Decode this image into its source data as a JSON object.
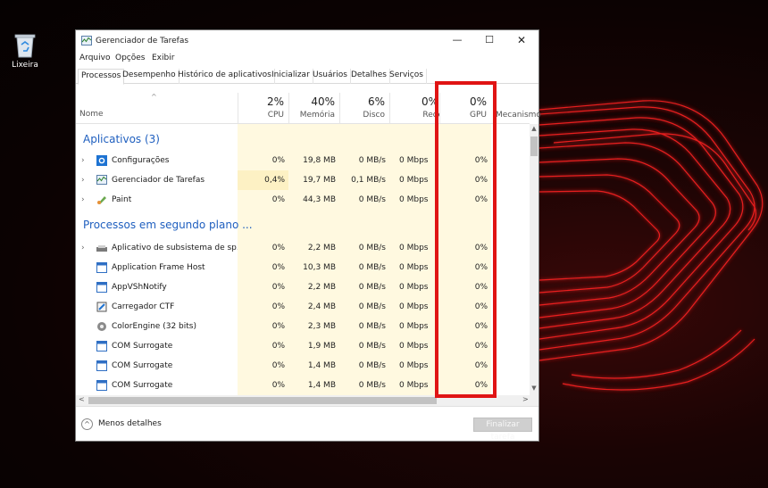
{
  "desktop": {
    "recycle_label": "Lixeira"
  },
  "window": {
    "title": "Gerenciador de Tarefas",
    "buttons": {
      "minimize": "—",
      "maximize": "☐",
      "close": "✕"
    },
    "menu": [
      "Arquivo",
      "Opções",
      "Exibir"
    ],
    "tabs": [
      "Processos",
      "Desempenho",
      "Histórico de aplicativos",
      "Inicializar",
      "Usuários",
      "Detalhes",
      "Serviços"
    ],
    "active_tab": "Processos"
  },
  "header": {
    "name": "Nome",
    "cpu": {
      "pct": "2%",
      "label": "CPU"
    },
    "memory": {
      "pct": "40%",
      "label": "Memória"
    },
    "disk": {
      "pct": "6%",
      "label": "Disco"
    },
    "network": {
      "pct": "0%",
      "label": "Rede"
    },
    "gpu": {
      "pct": "0%",
      "label": "GPU"
    },
    "engine": "Mecanismo"
  },
  "groups": {
    "apps": "Aplicativos (3)",
    "background": "Processos em segundo plano ..."
  },
  "apps": [
    {
      "name": "Configurações",
      "icon": "settings-gear-icon",
      "cpu": "0%",
      "mem": "19,8 MB",
      "disk": "0 MB/s",
      "net": "0 Mbps",
      "gpu": "0%"
    },
    {
      "name": "Gerenciador de Tarefas",
      "icon": "task-manager-icon",
      "cpu": "0,4%",
      "mem": "19,7 MB",
      "disk": "0,1 MB/s",
      "net": "0 Mbps",
      "gpu": "0%"
    },
    {
      "name": "Paint",
      "icon": "paint-icon",
      "cpu": "0%",
      "mem": "44,3 MB",
      "disk": "0 MB/s",
      "net": "0 Mbps",
      "gpu": "0%"
    }
  ],
  "background": [
    {
      "name": "Aplicativo de subsistema de sp...",
      "icon": "spooler-icon",
      "cpu": "0%",
      "mem": "2,2 MB",
      "disk": "0 MB/s",
      "net": "0 Mbps",
      "gpu": "0%"
    },
    {
      "name": "Application Frame Host",
      "icon": "app-window-icon",
      "cpu": "0%",
      "mem": "10,3 MB",
      "disk": "0 MB/s",
      "net": "0 Mbps",
      "gpu": "0%"
    },
    {
      "name": "AppVShNotify",
      "icon": "app-window-icon",
      "cpu": "0%",
      "mem": "2,2 MB",
      "disk": "0 MB/s",
      "net": "0 Mbps",
      "gpu": "0%"
    },
    {
      "name": "Carregador CTF",
      "icon": "ctf-loader-icon",
      "cpu": "0%",
      "mem": "2,4 MB",
      "disk": "0 MB/s",
      "net": "0 Mbps",
      "gpu": "0%"
    },
    {
      "name": "ColorEngine (32 bits)",
      "icon": "gear-cog-icon",
      "cpu": "0%",
      "mem": "2,3 MB",
      "disk": "0 MB/s",
      "net": "0 Mbps",
      "gpu": "0%"
    },
    {
      "name": "COM Surrogate",
      "icon": "app-window-icon",
      "cpu": "0%",
      "mem": "1,9 MB",
      "disk": "0 MB/s",
      "net": "0 Mbps",
      "gpu": "0%"
    },
    {
      "name": "COM Surrogate",
      "icon": "app-window-icon",
      "cpu": "0%",
      "mem": "1,4 MB",
      "disk": "0 MB/s",
      "net": "0 Mbps",
      "gpu": "0%"
    },
    {
      "name": "COM Surrogate",
      "icon": "app-window-icon",
      "cpu": "0%",
      "mem": "1,4 MB",
      "disk": "0 MB/s",
      "net": "0 Mbps",
      "gpu": "0%"
    }
  ],
  "footer": {
    "less_details": "Menos detalhes",
    "end_task": "Finalizar tarefa"
  },
  "colors": {
    "highlight_border": "#e01414",
    "heat_light": "#fff9e0",
    "heat_medium": "#fdf1c4",
    "group_title": "#1f5fbf"
  }
}
